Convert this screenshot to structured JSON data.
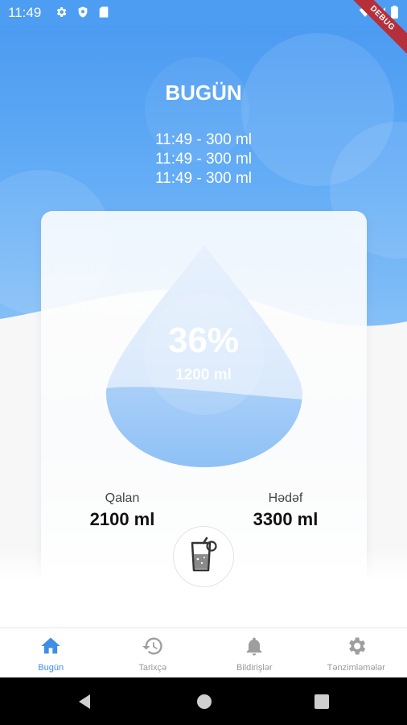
{
  "status_bar": {
    "time": "11:49",
    "icons": [
      "gear-icon",
      "shield-icon",
      "sd-card-icon",
      "wifi-icon",
      "signal-icon",
      "battery-icon"
    ],
    "debug_label": "DEBUG"
  },
  "header": {
    "title": "BUGÜN",
    "log_entries": [
      "11:49 - 300 ml",
      "11:49 - 300 ml",
      "11:49 - 300 ml"
    ]
  },
  "progress": {
    "percent_text": "36%",
    "amount_text": "1200 ml",
    "fill_fraction": 0.36
  },
  "stats": {
    "remaining_label": "Qalan",
    "remaining_value": "2100 ml",
    "goal_label": "Hədəf",
    "goal_value": "3300 ml"
  },
  "add_button": {
    "icon": "drink-glass-icon"
  },
  "bottom_nav": {
    "items": [
      {
        "label": "Bugün",
        "icon": "home-icon",
        "active": true
      },
      {
        "label": "Tarixçə",
        "icon": "history-icon",
        "active": false
      },
      {
        "label": "Bildirişlər",
        "icon": "bell-icon",
        "active": false
      },
      {
        "label": "Tənzimləmələr",
        "icon": "settings-icon",
        "active": false
      }
    ]
  },
  "colors": {
    "primary": "#4b9bf2",
    "drop_fill": "#8dbff6",
    "active_nav": "#3f8ee8",
    "inactive_nav": "#b3b3b3"
  }
}
